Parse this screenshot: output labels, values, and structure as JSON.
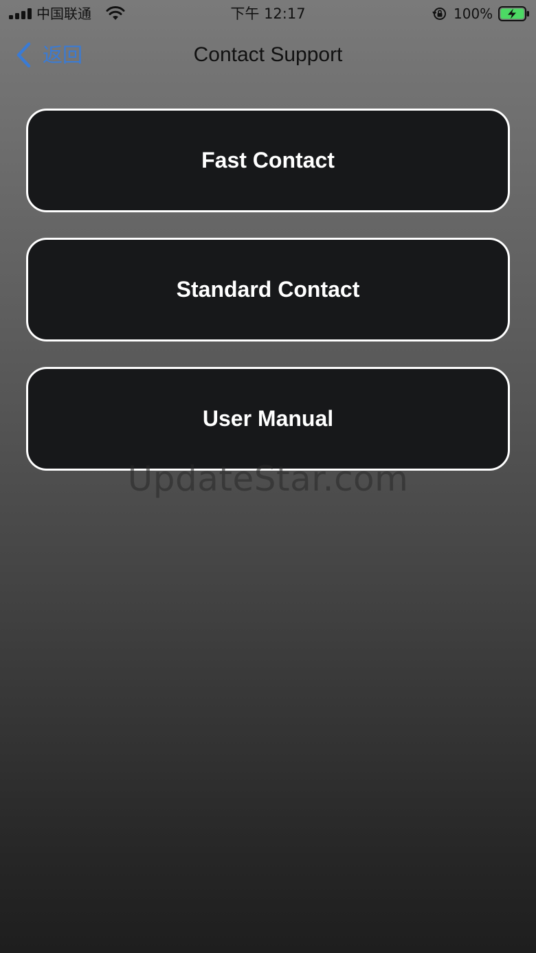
{
  "status_bar": {
    "carrier": "中国联通",
    "time": "下午 12:17",
    "battery_percent": "100%",
    "icons": {
      "signal": "signal-bars-icon",
      "wifi": "wifi-icon",
      "orientation_lock": "orientation-lock-icon",
      "battery": "battery-charging-icon"
    },
    "battery_color": "#4cd964"
  },
  "nav": {
    "back_label": "返回",
    "title": "Contact Support",
    "back_color": "#3a7bd5"
  },
  "menu": {
    "items": [
      {
        "label": "Fast Contact"
      },
      {
        "label": "Standard Contact"
      },
      {
        "label": "User Manual"
      }
    ]
  },
  "watermark": {
    "text": "UpdateStar.com"
  }
}
